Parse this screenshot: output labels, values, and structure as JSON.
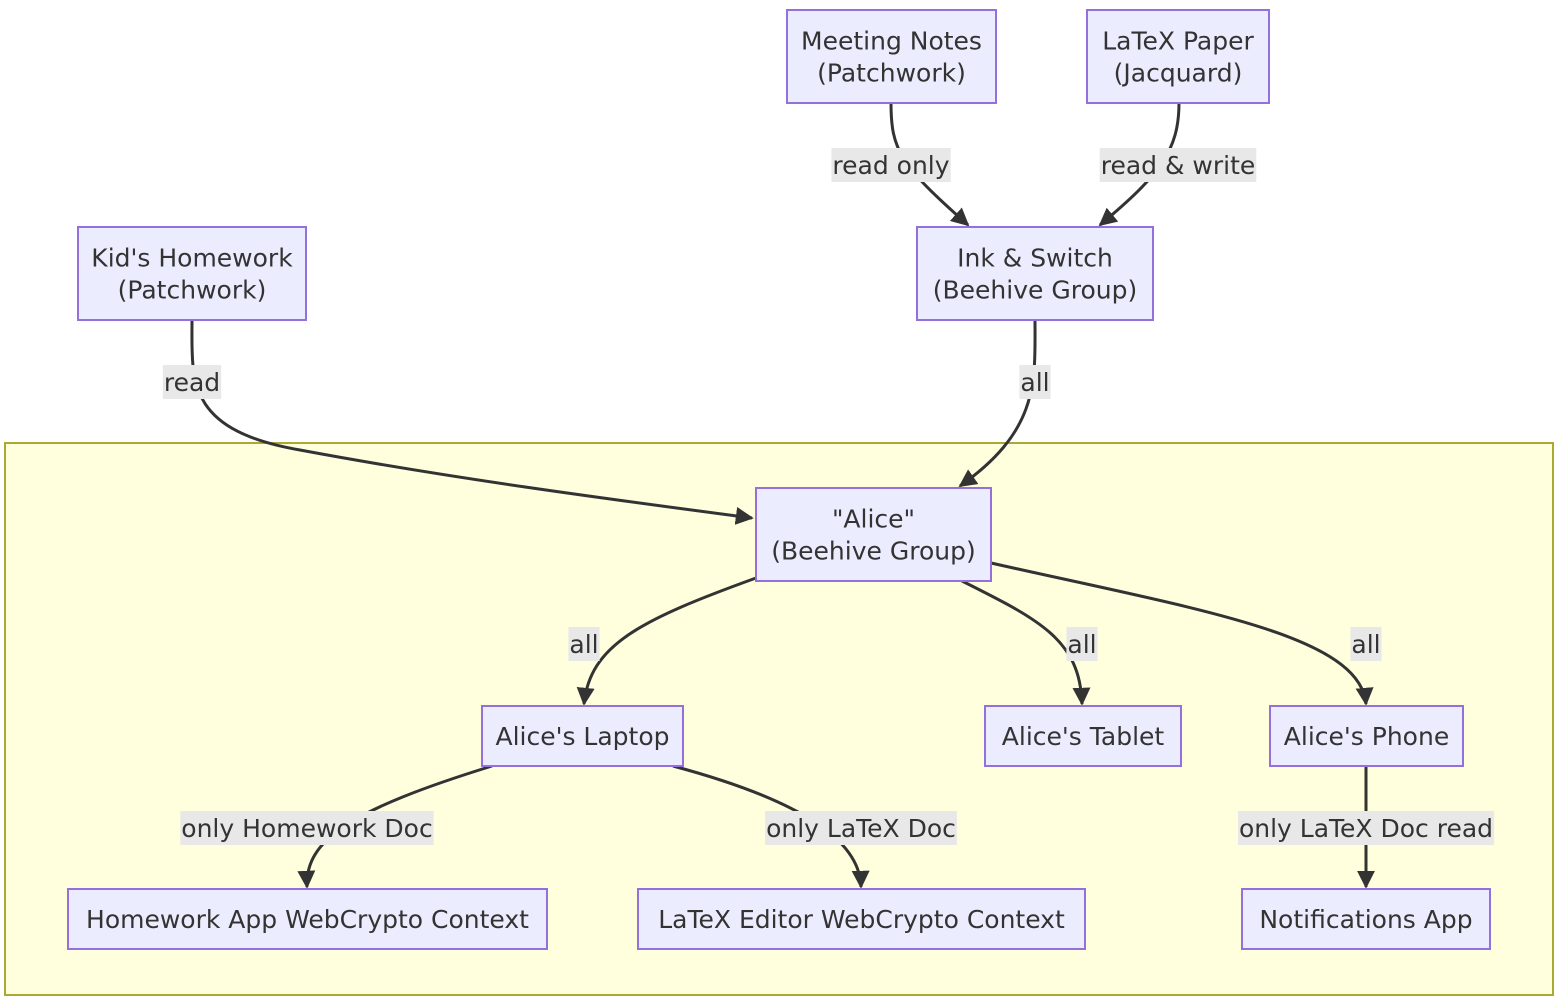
{
  "diagram": {
    "colors": {
      "node_fill": "#ECECFF",
      "node_stroke": "#9370DB",
      "edge": "#333333",
      "label_bg": "#e8e8e8",
      "cluster_fill": "#ffffde",
      "cluster_stroke": "#aaaa33"
    },
    "nodes": [
      {
        "id": "meeting",
        "lines": [
          "Meeting Notes",
          "(Patchwork)"
        ]
      },
      {
        "id": "latexpaper",
        "lines": [
          "LaTeX Paper",
          "(Jacquard)"
        ]
      },
      {
        "id": "kid",
        "lines": [
          "Kid's Homework",
          "(Patchwork)"
        ]
      },
      {
        "id": "ink",
        "lines": [
          "Ink & Switch",
          "(Beehive Group)"
        ]
      },
      {
        "id": "alice",
        "lines": [
          "\"Alice\"",
          "(Beehive Group)"
        ]
      },
      {
        "id": "laptop",
        "lines": [
          "Alice's Laptop"
        ]
      },
      {
        "id": "tablet",
        "lines": [
          "Alice's Tablet"
        ]
      },
      {
        "id": "phone",
        "lines": [
          "Alice's Phone"
        ]
      },
      {
        "id": "homeworkapp",
        "lines": [
          "Homework App WebCrypto Context"
        ]
      },
      {
        "id": "latexeditor",
        "lines": [
          "LaTeX Editor WebCrypto Context"
        ]
      },
      {
        "id": "notifications",
        "lines": [
          "Notifications App"
        ]
      }
    ],
    "edges": [
      {
        "from": "meeting",
        "to": "ink",
        "label": "read only"
      },
      {
        "from": "latexpaper",
        "to": "ink",
        "label": "read & write"
      },
      {
        "from": "kid",
        "to": "alice",
        "label": "read"
      },
      {
        "from": "ink",
        "to": "alice",
        "label": "all"
      },
      {
        "from": "alice",
        "to": "laptop",
        "label": "all"
      },
      {
        "from": "alice",
        "to": "tablet",
        "label": "all"
      },
      {
        "from": "alice",
        "to": "phone",
        "label": "all"
      },
      {
        "from": "laptop",
        "to": "homeworkapp",
        "label": "only Homework Doc"
      },
      {
        "from": "laptop",
        "to": "latexeditor",
        "label": "only LaTeX Doc"
      },
      {
        "from": "phone",
        "to": "notifications",
        "label": "only LaTeX Doc read"
      }
    ]
  }
}
